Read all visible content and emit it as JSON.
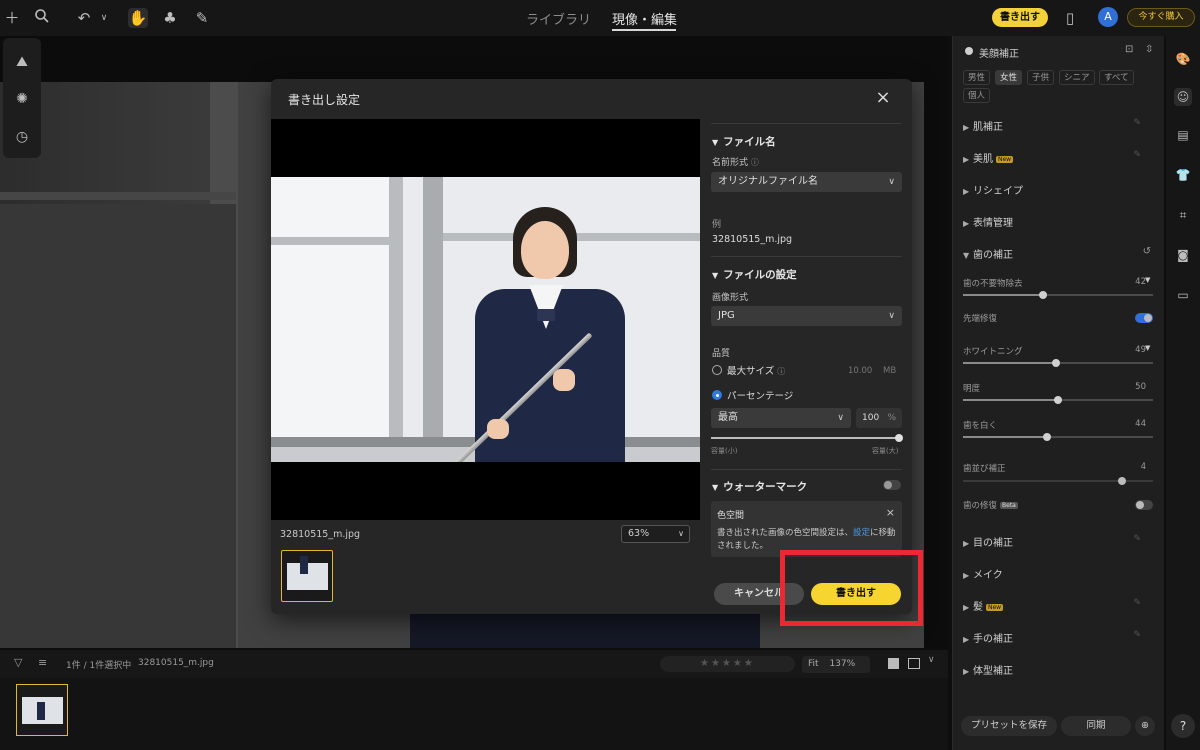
{
  "topbar": {
    "tabs": [
      "ライブラリ",
      "現像・編集"
    ],
    "export_button": "書き出す",
    "avatar_initial": "A",
    "buy_button": "今すぐ購入",
    "icons": [
      "plus-icon",
      "search-icon",
      "undo-icon",
      "chevron-down-icon",
      "hand-icon",
      "tree-icon",
      "brush-icon",
      "compare-icon"
    ]
  },
  "left_tools": {
    "icons": [
      "mountain-sparkle-icon",
      "sun-icon",
      "history-icon"
    ]
  },
  "modal": {
    "title": "書き出し設定",
    "close_icon": "×",
    "preview": {
      "filename": "32810515_m.jpg",
      "zoom": "63%"
    },
    "file_name_section": {
      "title": "ファイル名",
      "naming_label": "名前形式",
      "naming_value": "オリジナルファイル名",
      "example_label": "例",
      "example_value": "32810515_m.jpg"
    },
    "file_settings_section": {
      "title": "ファイルの設定",
      "format_label": "画像形式",
      "format_value": "JPG",
      "quality_label": "品質",
      "max_size_label": "最大サイズ",
      "max_size_value": "10.00",
      "max_size_unit": "MB",
      "percentage_label": "パーセンテージ",
      "quality_select": "最高",
      "quality_percent": "100",
      "percent_unit": "%",
      "slider_min_label": "容量(小)",
      "slider_max_label": "容量(大)",
      "quality_slider_level": 1.0
    },
    "watermark_section": {
      "title": "ウォーターマーク",
      "enabled": false
    },
    "info_box": {
      "title": "色空間",
      "close": "×",
      "message_before": "書き出された画像の色空間設定は、",
      "message_link": "設定",
      "message_after": "に移動されました。"
    },
    "cancel_button": "キャンセル",
    "export_button": "書き出す"
  },
  "right_panel": {
    "title": "美顔補正",
    "chips": [
      "男性",
      "女性",
      "子供",
      "シニア",
      "すべて",
      "個人"
    ],
    "active_chip": "女性",
    "sections_top": [
      {
        "label": "肌補正",
        "new": false
      },
      {
        "label": "美肌",
        "new": true
      },
      {
        "label": "リシェイプ",
        "new": false
      },
      {
        "label": "表情管理",
        "new": false
      }
    ],
    "new_badge": "New",
    "beta_badge": "Beta",
    "teeth_section": {
      "title": "歯の補正",
      "sliders": [
        {
          "label": "歯の不要物除去",
          "value": "42",
          "level": 0.42
        },
        {
          "label": "ホワイトニング",
          "value": "49",
          "level": 0.49
        },
        {
          "label": "明度",
          "value": "50",
          "level": 0.5
        },
        {
          "label": "歯を白く",
          "value": "44",
          "level": 0.44
        }
      ],
      "edge_fix_label": "先端修復",
      "alignment_label": "歯並び補正",
      "alignment_value": "4",
      "repair_label": "歯の修復"
    },
    "sections_bottom": [
      {
        "label": "目の補正",
        "new": false
      },
      {
        "label": "メイク",
        "new": false
      },
      {
        "label": "髪",
        "new": true
      },
      {
        "label": "手の補正",
        "new": false
      },
      {
        "label": "体型補正",
        "new": false
      }
    ],
    "save_preset_button": "プリセットを保存",
    "sync_button": "同期"
  },
  "icon_strip": {
    "icons": [
      "palette-icon",
      "face-icon",
      "layers-icon",
      "shirt-icon",
      "crop-icon",
      "camera-icon",
      "folder-icon"
    ],
    "help": "?"
  },
  "bottom_bar": {
    "selection_text": "1件 / 1件選択中",
    "filename": "32810515_m.jpg",
    "fit_label": "Fit",
    "zoom_value": "137%"
  }
}
